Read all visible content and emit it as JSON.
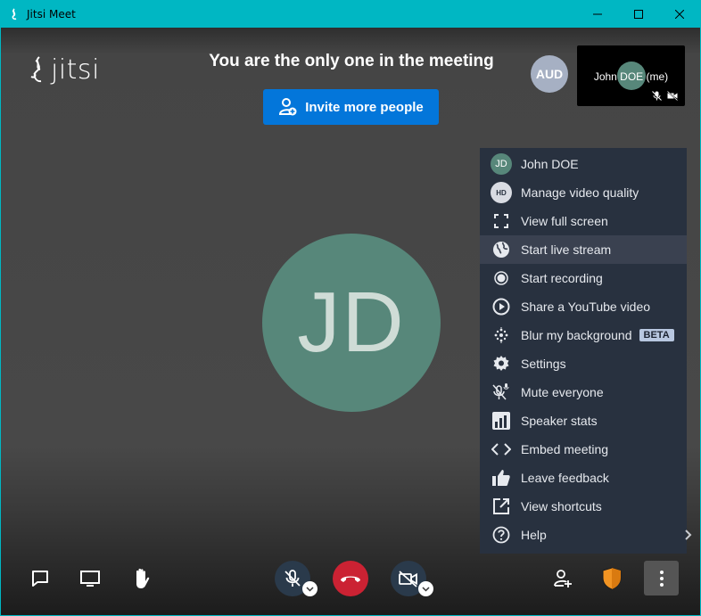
{
  "window": {
    "title": "Jitsi Meet",
    "accent_color": "#00b7c3",
    "controls": [
      "minimize-icon",
      "maximize-icon",
      "close-icon"
    ]
  },
  "header": {
    "logo_text": "jitsi",
    "notice": "You are the only one in the meeting",
    "invite_button": "Invite more people"
  },
  "participants": {
    "remote_avatar_initials": "AUD",
    "self_name": "John DOE (me)",
    "self_initials": "JD"
  },
  "menu": {
    "items": [
      {
        "label": "John DOE",
        "icon": "avatar-jd",
        "avatar_text": "JD"
      },
      {
        "label": "Manage video quality",
        "icon": "hd-icon",
        "badge_text": "HD"
      },
      {
        "label": "View full screen",
        "icon": "fullscreen-icon"
      },
      {
        "label": "Start live stream",
        "icon": "globe-icon"
      },
      {
        "label": "Start recording",
        "icon": "record-icon"
      },
      {
        "label": "Share a YouTube video",
        "icon": "play-icon"
      },
      {
        "label": "Blur my background",
        "icon": "blur-icon",
        "tag": "BETA"
      },
      {
        "label": "Settings",
        "icon": "gear-icon"
      },
      {
        "label": "Mute everyone",
        "icon": "mute-everyone-icon"
      },
      {
        "label": "Speaker stats",
        "icon": "stats-icon"
      },
      {
        "label": "Embed meeting",
        "icon": "code-icon"
      },
      {
        "label": "Leave feedback",
        "icon": "thumbs-up-icon"
      },
      {
        "label": "View shortcuts",
        "icon": "external-link-icon"
      },
      {
        "label": "Help",
        "icon": "help-icon"
      }
    ],
    "highlighted_item": "Start live stream"
  },
  "toolbar": {
    "left": [
      "chat-icon",
      "screen-share-icon",
      "raise-hand-icon"
    ],
    "center": [
      "microphone-muted-icon",
      "hangup-icon",
      "camera-off-icon"
    ],
    "right": [
      "add-participant-icon",
      "security-shield-icon",
      "more-options-icon"
    ],
    "hangup_color": "#cb2233",
    "shield_color": "#f29423"
  }
}
